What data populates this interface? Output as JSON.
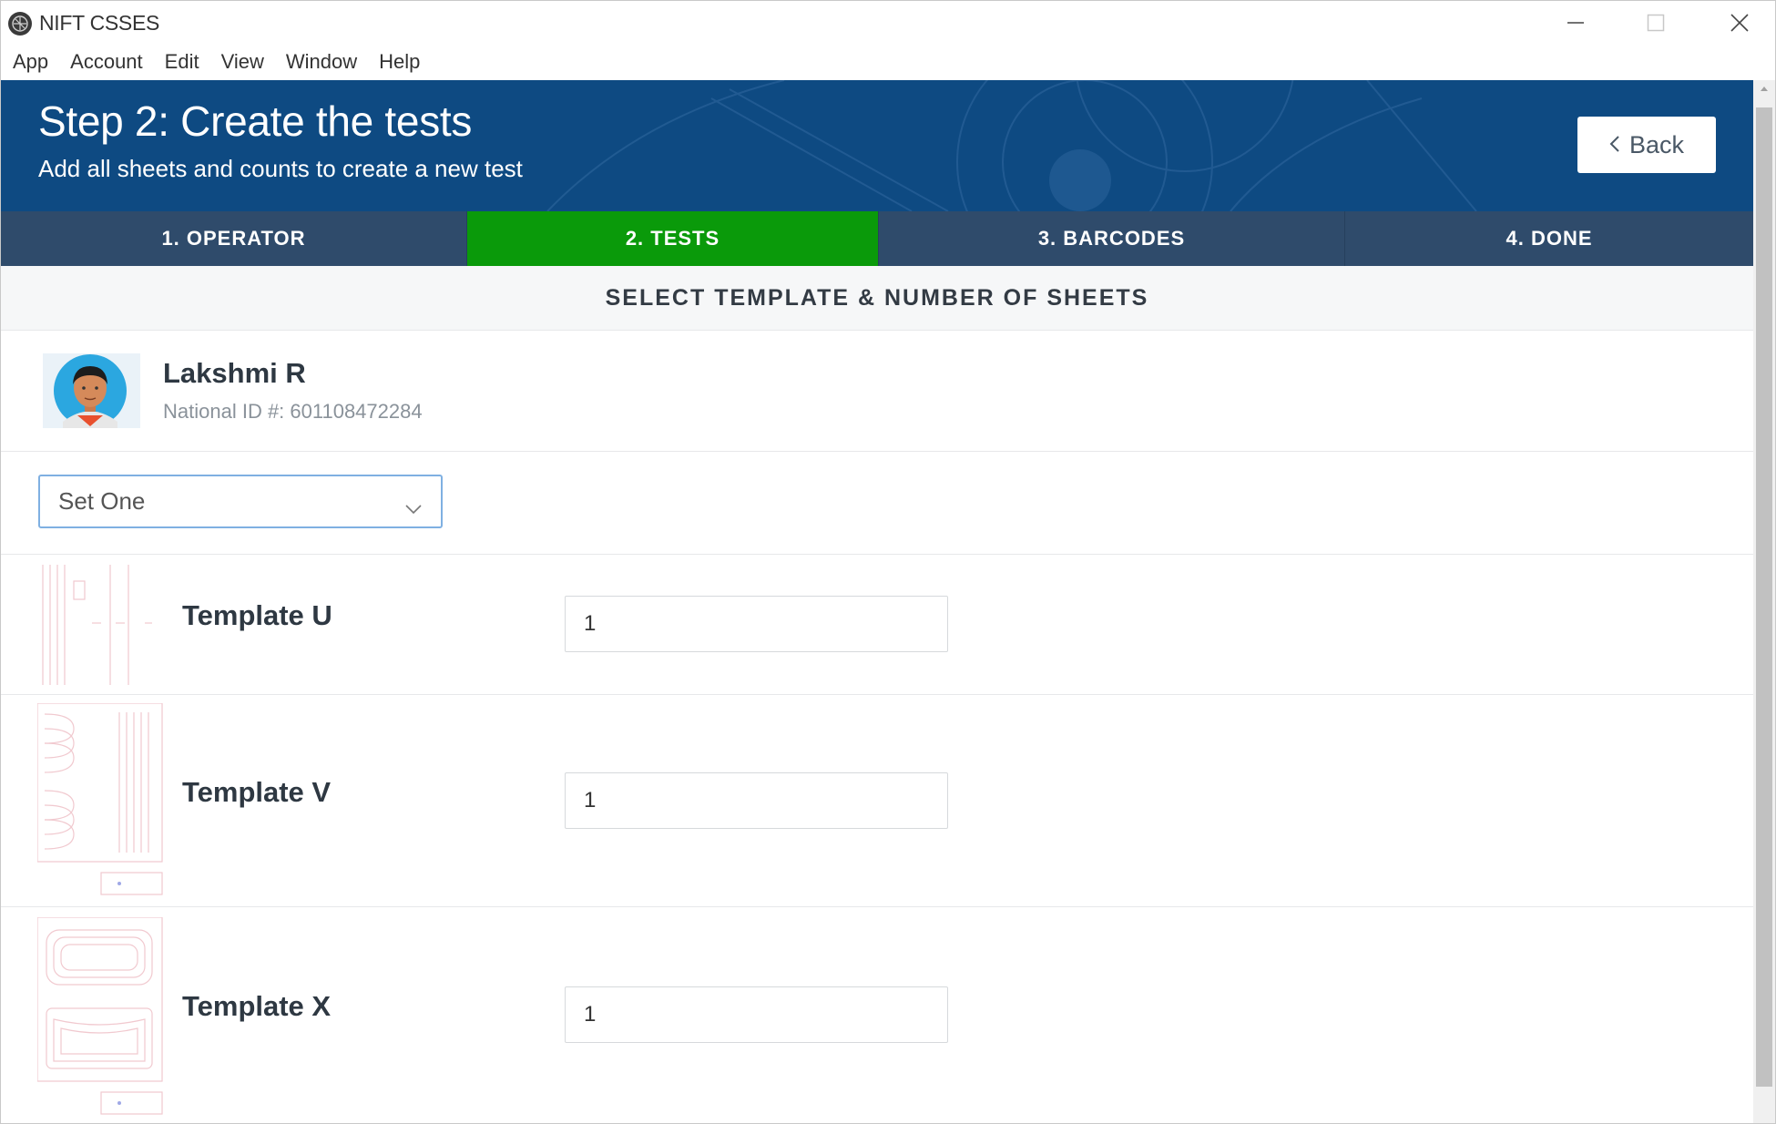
{
  "window": {
    "title": "NIFT CSSES",
    "controls": [
      "minimize-icon",
      "maximize-icon",
      "close-icon"
    ]
  },
  "menubar": {
    "items": [
      "App",
      "Account",
      "Edit",
      "View",
      "Window",
      "Help"
    ]
  },
  "header": {
    "title": "Step 2: Create the tests",
    "subtitle": "Add all sheets and counts to create a new test",
    "back_label": "Back",
    "back_icon": "chevron-left-icon",
    "background_color": "#0e4a82"
  },
  "steps": {
    "tabs": [
      {
        "label": "1. OPERATOR",
        "active": false
      },
      {
        "label": "2. TESTS",
        "active": true
      },
      {
        "label": "3. BARCODES",
        "active": false
      },
      {
        "label": "4. DONE",
        "active": false
      }
    ],
    "active_color": "#0a9a0a",
    "inactive_color": "#2f4b6b"
  },
  "section": {
    "title": "SELECT TEMPLATE & NUMBER OF SHEETS"
  },
  "operator": {
    "name": "Lakshmi R",
    "national_id": "National ID #: 601108472284",
    "avatar_icon": "person-avatar-icon"
  },
  "template_set": {
    "selected": "Set One",
    "icon": "chevron-down-icon"
  },
  "templates": [
    {
      "name": "Template U",
      "count": "1"
    },
    {
      "name": "Template V",
      "count": "1"
    },
    {
      "name": "Template X",
      "count": "1"
    }
  ]
}
